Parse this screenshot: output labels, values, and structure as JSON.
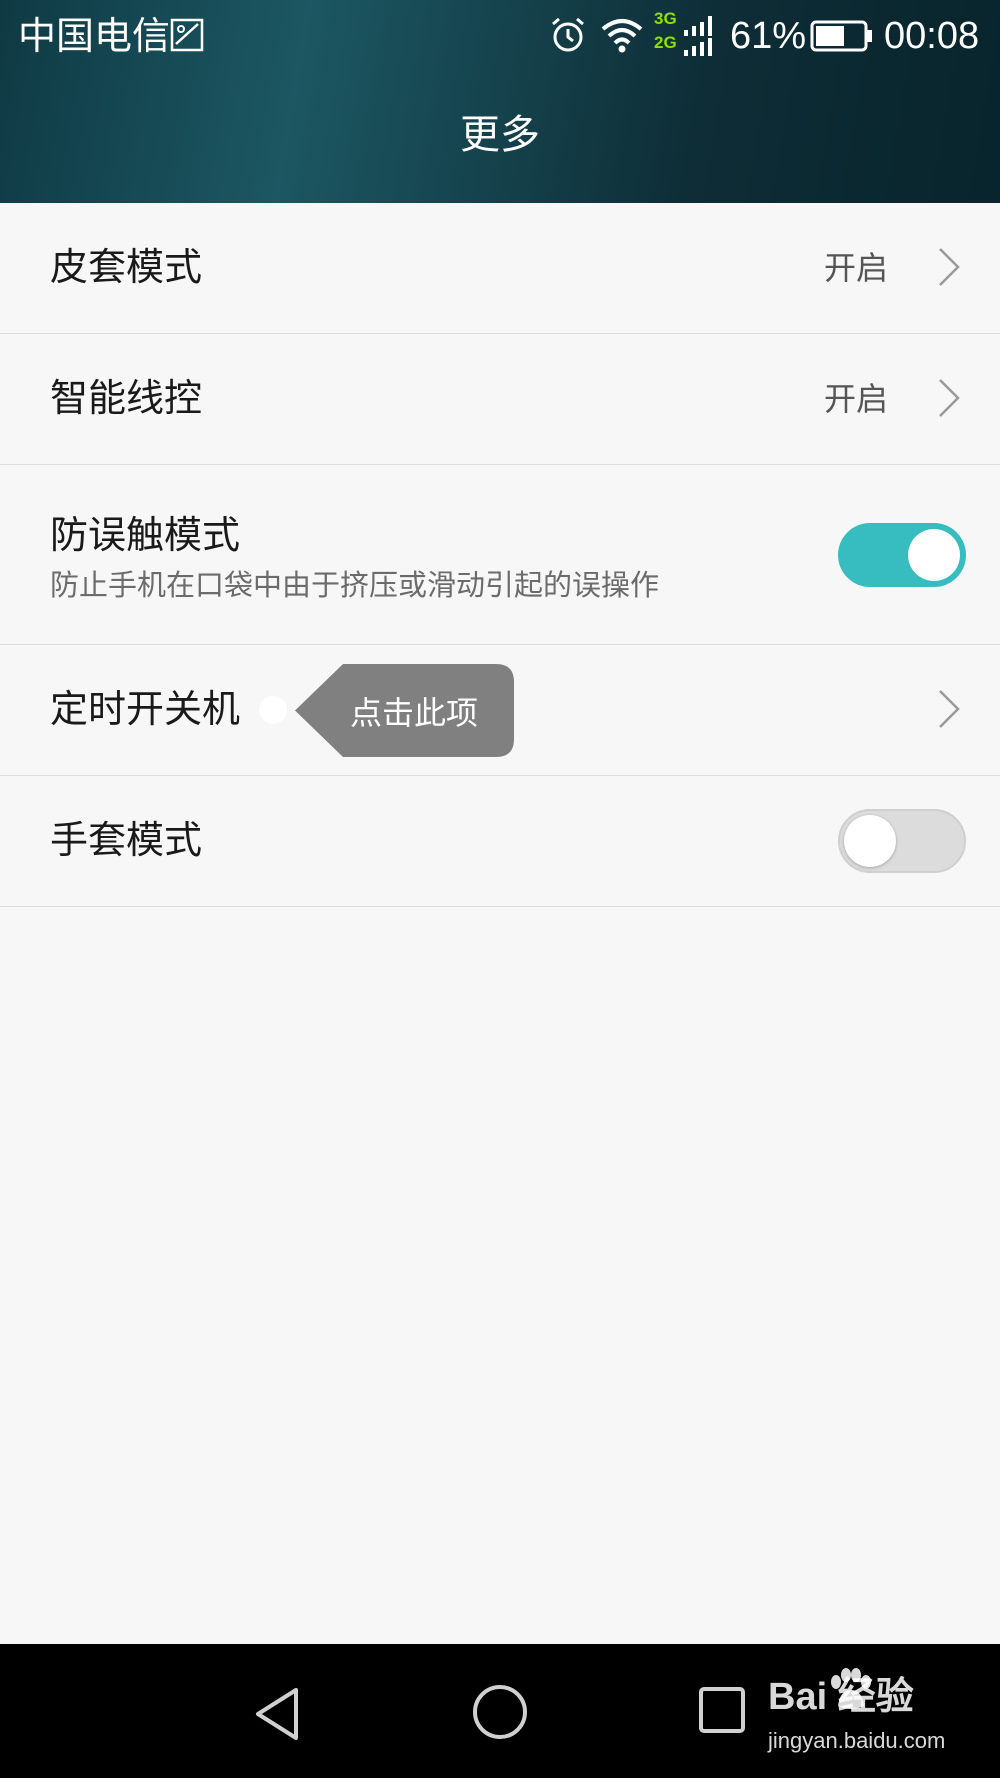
{
  "status_bar": {
    "carrier": "中国电信",
    "network_top": "3G",
    "network_bottom": "2G",
    "battery_percent": "61%",
    "battery_level": 0.61,
    "time": "00:08"
  },
  "header": {
    "title": "更多"
  },
  "settings": [
    {
      "title": "皮套模式",
      "value": "开启",
      "control": "chevron"
    },
    {
      "title": "智能线控",
      "value": "开启",
      "control": "chevron"
    },
    {
      "title": "防误触模式",
      "subtitle": "防止手机在口袋中由于挤压或滑动引起的误操作",
      "control": "toggle",
      "on": true
    },
    {
      "title": "定时开关机",
      "control": "chevron"
    },
    {
      "title": "手套模式",
      "control": "toggle",
      "on": false
    }
  ],
  "tooltip": {
    "text": "点击此项"
  },
  "watermark": {
    "logo": "Bai 经验",
    "url": "jingyan.baidu.com"
  },
  "colors": {
    "accent": "#37bdbf",
    "header_dark": "#0e2d36",
    "network_green": "#8ee000",
    "tooltip_bg": "#808080"
  },
  "icons": [
    "sim-card-icon",
    "alarm-icon",
    "wifi-icon",
    "signal-icon",
    "battery-icon",
    "chevron-right-icon",
    "back-icon",
    "home-icon",
    "recents-icon",
    "baidu-paw-icon"
  ]
}
